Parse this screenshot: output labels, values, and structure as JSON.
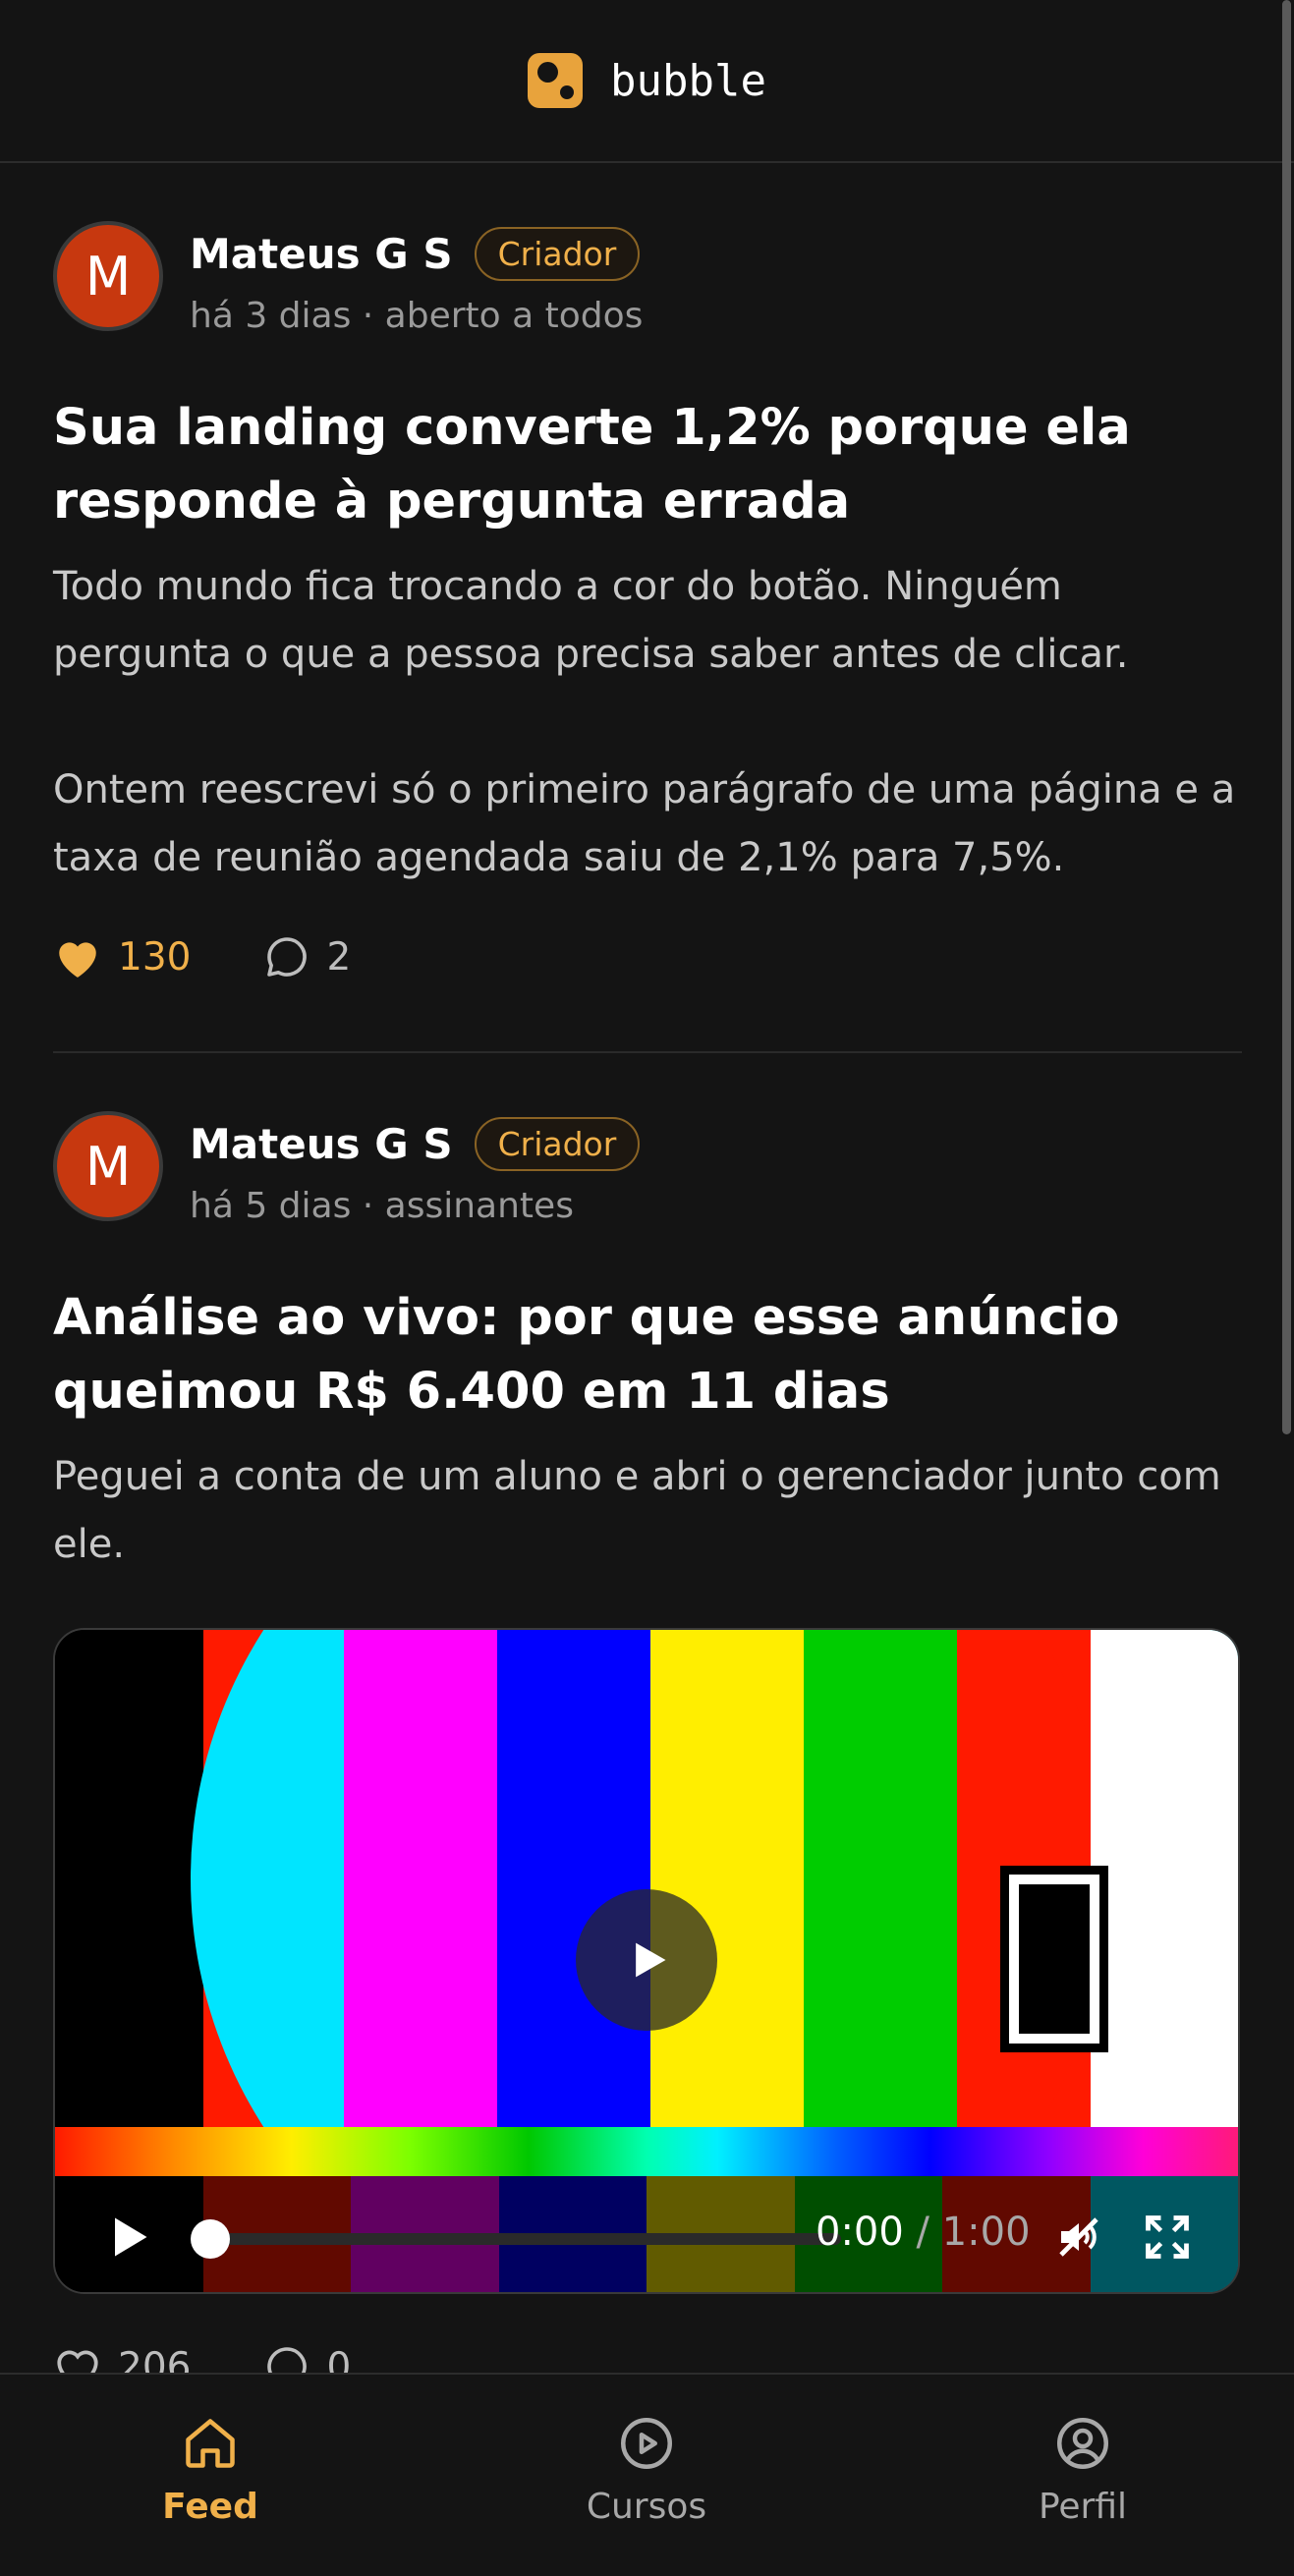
{
  "app": {
    "name": "bubble"
  },
  "colors": {
    "accent": "#f0b04a",
    "background": "#141414",
    "avatar": "#c7380f"
  },
  "posts": [
    {
      "author": "Mateus G S",
      "avatar_initial": "M",
      "badge": "Criador",
      "meta": "há 3 dias · aberto a todos",
      "title": "Sua landing converte 1,2% porque ela responde à pergunta errada",
      "body": [
        "Todo mundo fica trocando a cor do botão. Ninguém pergunta o que a pessoa precisa saber antes de clicar.",
        "Ontem reescrevi só o primeiro parágrafo de uma página e a taxa de reunião agendada saiu de 2,1% para 7,5%."
      ],
      "likes": "130",
      "liked": true,
      "comments": "2"
    },
    {
      "author": "Mateus G S",
      "avatar_initial": "M",
      "badge": "Criador",
      "meta": "há 5 dias · assinantes",
      "title": "Análise ao vivo: por que esse anúncio queimou R$ 6.400 em 11 dias",
      "body": [
        "Peguei a conta de um aluno e abri o gerenciador junto com ele."
      ],
      "video": {
        "current_time": "0:00",
        "separator": " / ",
        "duration": "1:00",
        "progress": 0,
        "muted": true,
        "icons": [
          "play-icon",
          "mute-icon",
          "fullscreen-icon"
        ]
      },
      "likes": "206",
      "liked": false,
      "comments": "0"
    }
  ],
  "nav": [
    {
      "label": "Feed",
      "icon": "home-icon",
      "active": true
    },
    {
      "label": "Cursos",
      "icon": "play-circle-icon",
      "active": false
    },
    {
      "label": "Perfil",
      "icon": "user-circle-icon",
      "active": false
    }
  ]
}
